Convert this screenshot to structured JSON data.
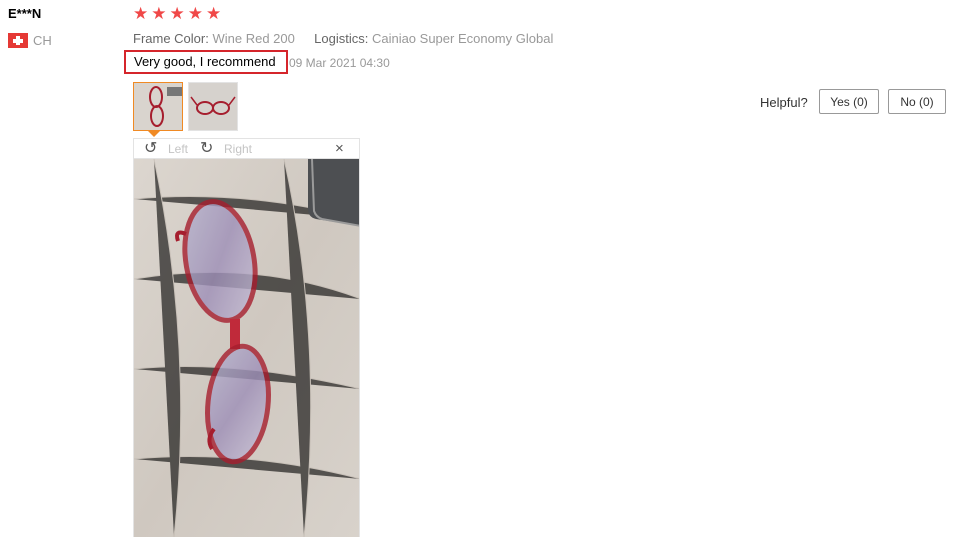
{
  "review": {
    "user_name": "E***N",
    "country_code": "CH",
    "rating": 5,
    "stars": [
      "★",
      "★",
      "★",
      "★",
      "★"
    ],
    "attributes": [
      {
        "key": "Frame Color:",
        "value": "Wine Red 200"
      },
      {
        "key": "Logistics:",
        "value": "Cainiao Super Economy Global"
      }
    ],
    "comment": "Very good, I recommend",
    "date": "09 Mar 2021 04:30",
    "helpful": {
      "label": "Helpful?",
      "yes_label": "Yes (0)",
      "no_label": "No (0)"
    }
  },
  "viewer": {
    "rotate_left_label": "Left",
    "rotate_right_label": "Right",
    "rotate_left_icon": "↺",
    "rotate_right_icon": "↻",
    "close_icon": "×"
  },
  "colors": {
    "star": "#f04848",
    "highlight_border": "#d5252b",
    "thumb_selected_border": "#f08a24",
    "frame_color": "#a61e2e"
  }
}
